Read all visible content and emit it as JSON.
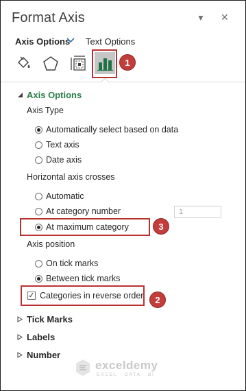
{
  "pane": {
    "title": "Format Axis",
    "menu_glyph": "▼",
    "close_glyph": "✕"
  },
  "tabs": [
    {
      "label": "Axis Options",
      "active": true
    },
    {
      "label": "Text Options",
      "active": false
    }
  ],
  "icon_tabs": [
    "fill-line-icon",
    "effects-pentagon-icon",
    "size-properties-icon",
    "axis-options-bar-chart-icon"
  ],
  "annotations": {
    "badge_1": "1",
    "badge_2": "2",
    "badge_3": "3",
    "highlight_color": "#b83232"
  },
  "axis_options": {
    "header": "Axis Options",
    "axis_type": {
      "label": "Axis Type",
      "options": [
        {
          "label": "Automatically select based on data",
          "selected": true
        },
        {
          "label": "Text axis",
          "selected": false
        },
        {
          "label": "Date axis",
          "selected": false
        }
      ]
    },
    "horizontal_axis_crosses": {
      "label": "Horizontal axis crosses",
      "options": [
        {
          "label": "Automatic",
          "selected": false
        },
        {
          "label": "At category number",
          "selected": false
        },
        {
          "label": "At maximum category",
          "selected": true
        }
      ],
      "category_number_value": "1"
    },
    "axis_position": {
      "label": "Axis position",
      "options": [
        {
          "label": "On tick marks",
          "selected": false
        },
        {
          "label": "Between tick marks",
          "selected": true
        }
      ]
    },
    "reverse_order": {
      "label": "Categories in reverse order",
      "checked": true
    }
  },
  "collapsed_sections": [
    "Tick Marks",
    "Labels",
    "Number"
  ],
  "watermark": {
    "name": "exceldemy",
    "tagline": "EXCEL · DATA · BI"
  },
  "colors": {
    "accent_green": "#2a7c47",
    "chart_icon_green": "#217346",
    "selected_icon_bg": "#c6c6c6"
  }
}
